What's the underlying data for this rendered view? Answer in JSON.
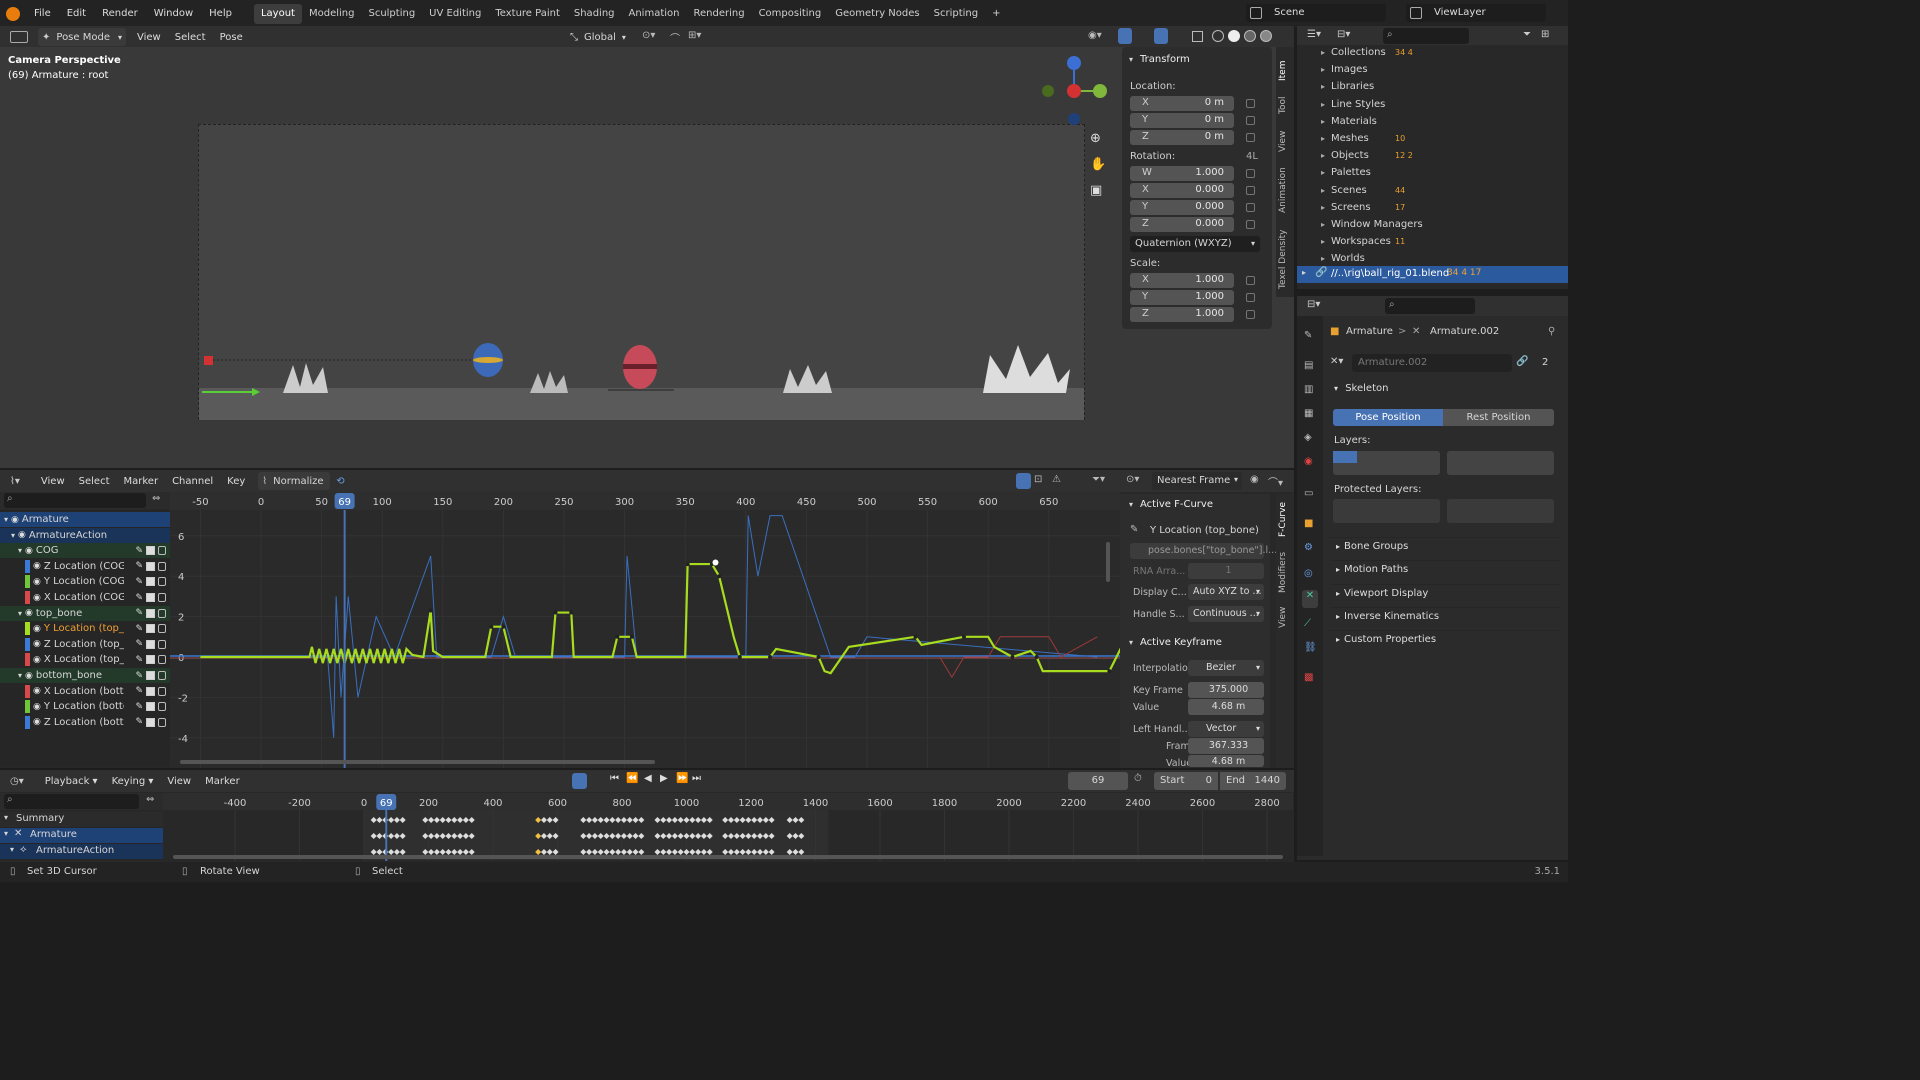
{
  "topbar": {
    "menus": [
      "File",
      "Edit",
      "Render",
      "Window",
      "Help"
    ],
    "workspaces": [
      "Layout",
      "Modeling",
      "Sculpting",
      "UV Editing",
      "Texture Paint",
      "Shading",
      "Animation",
      "Rendering",
      "Compositing",
      "Geometry Nodes",
      "Scripting"
    ],
    "active_workspace": "Layout",
    "add_tab": "+",
    "scene": "Scene",
    "view_layer": "ViewLayer"
  },
  "viewport": {
    "mode": "Pose Mode",
    "menus": [
      "View",
      "Select",
      "Pose"
    ],
    "orientation": "Global",
    "camera_title": "Camera Perspective",
    "camera_subtitle": "(69) Armature : root"
  },
  "transform_panel": {
    "title": "Transform",
    "location_label": "Location:",
    "location": [
      {
        "k": "X",
        "v": "0 m"
      },
      {
        "k": "Y",
        "v": "0 m"
      },
      {
        "k": "Z",
        "v": "0 m"
      }
    ],
    "rotation_label": "Rotation:",
    "rotation_mode_short": "4L",
    "rotation": [
      {
        "k": "W",
        "v": "1.000"
      },
      {
        "k": "X",
        "v": "0.000"
      },
      {
        "k": "Y",
        "v": "0.000"
      },
      {
        "k": "Z",
        "v": "0.000"
      }
    ],
    "rotation_mode": "Quaternion (WXYZ)",
    "scale_label": "Scale:",
    "scale": [
      {
        "k": "X",
        "v": "1.000"
      },
      {
        "k": "Y",
        "v": "1.000"
      },
      {
        "k": "Z",
        "v": "1.000"
      }
    ]
  },
  "viewport_tabs": [
    "Item",
    "Tool",
    "View",
    "Animation",
    "Texel Density"
  ],
  "outliner": {
    "items": [
      {
        "label": "Collections",
        "badges": "34 4"
      },
      {
        "label": "Images",
        "badges": ""
      },
      {
        "label": "Libraries",
        "badges": ""
      },
      {
        "label": "Line Styles",
        "badges": ""
      },
      {
        "label": "Materials",
        "badges": ""
      },
      {
        "label": "Meshes",
        "badges": "10"
      },
      {
        "label": "Objects",
        "badges": "12 2"
      },
      {
        "label": "Palettes",
        "badges": ""
      },
      {
        "label": "Scenes",
        "badges": "44"
      },
      {
        "label": "Screens",
        "badges": "17"
      },
      {
        "label": "Window Managers",
        "badges": ""
      },
      {
        "label": "Workspaces",
        "badges": "11"
      },
      {
        "label": "Worlds",
        "badges": ""
      }
    ],
    "file": "//..\\rig\\ball_rig_01.blend",
    "file_badges": "34 4 17"
  },
  "properties": {
    "breadcrumb_1": "Armature",
    "breadcrumb_sep": ">",
    "breadcrumb_2": "Armature.002",
    "data_name": "Armature.002",
    "users": "2",
    "skeleton_title": "Skeleton",
    "pose_position": "Pose Position",
    "rest_position": "Rest Position",
    "layers_label": "Layers:",
    "protected_layers_label": "Protected Layers:",
    "sections": [
      "Bone Groups",
      "Motion Paths",
      "Viewport Display",
      "Inverse Kinematics",
      "Custom Properties"
    ]
  },
  "graph_editor": {
    "menus": [
      "View",
      "Select",
      "Marker",
      "Channel",
      "Key"
    ],
    "normalize": "Normalize",
    "snap_mode": "Nearest Frame",
    "frame_ticks": [
      "-50",
      "0",
      "50",
      "69",
      "100",
      "150",
      "200",
      "250",
      "300",
      "350",
      "400",
      "450",
      "500",
      "550",
      "600",
      "650"
    ],
    "current_frame": "69",
    "y_ticks": [
      "6",
      "4",
      "2",
      "0",
      "-2",
      "-4"
    ],
    "channels": [
      {
        "label": "Armature",
        "level": 0,
        "color": "#2b5fa0"
      },
      {
        "label": "ArmatureAction",
        "level": 1,
        "color": ""
      },
      {
        "label": "COG",
        "level": 2,
        "color": ""
      },
      {
        "label": "Z Location (COG)",
        "level": 3,
        "color": "#3a7bd5"
      },
      {
        "label": "Y Location (COG)",
        "level": 3,
        "color": "#6fc63a"
      },
      {
        "label": "X Location (COG)",
        "level": 3,
        "color": "#d84a4a"
      },
      {
        "label": "top_bone",
        "level": 2,
        "color": ""
      },
      {
        "label": "Y Location (top_bor",
        "level": 3,
        "color": "#a8dc1e"
      },
      {
        "label": "Z Location (top_bor",
        "level": 3,
        "color": "#3a7bd5"
      },
      {
        "label": "X Location (top_bor",
        "level": 3,
        "color": "#d84a4a"
      },
      {
        "label": "bottom_bone",
        "level": 2,
        "color": ""
      },
      {
        "label": "X Location (bottom",
        "level": 3,
        "color": "#d84a4a"
      },
      {
        "label": "Y Location (bottom",
        "level": 3,
        "color": "#6fc63a"
      },
      {
        "label": "Z Location (bottom",
        "level": 3,
        "color": "#3a7bd5"
      }
    ]
  },
  "fcurve_panel": {
    "active_fcurve_title": "Active F-Curve",
    "fcurve_name": "Y Location (top_bone)",
    "data_path": "pose.bones[\"top_bone\"].l...",
    "rna_array_label": "RNA Arra...",
    "rna_array_value": "1",
    "display_color_label": "Display C...",
    "display_color_value": "Auto XYZ to ...",
    "handle_smoothing_label": "Handle S...",
    "handle_smoothing_value": "Continuous ...",
    "active_keyframe_title": "Active Keyframe",
    "interpolation_label": "Interpolation",
    "interpolation_value": "Bezier",
    "key_frame_label": "Key Frame",
    "key_frame_value": "375.000",
    "value_label": "Value",
    "value_value": "4.68 m",
    "left_handle_label": "Left Handl...",
    "left_handle_value": "Vector",
    "lh_frame_label": "Frame",
    "lh_frame_value": "367.333",
    "lh_value_label": "Value",
    "lh_value_value": "4.68 m",
    "tabs": [
      "F-Curve",
      "Modifiers",
      "View"
    ]
  },
  "timeline": {
    "menus": [
      "Playback",
      "Keying",
      "View",
      "Marker"
    ],
    "current_frame": "69",
    "start_label": "Start",
    "start_value": "0",
    "end_label": "End",
    "end_value": "1440",
    "ticks": [
      "-400",
      "-200",
      "0",
      "69",
      "200",
      "400",
      "600",
      "800",
      "1000",
      "1200",
      "1400",
      "1600",
      "1800",
      "2000",
      "2200",
      "2400",
      "2600",
      "2800"
    ],
    "channels": [
      "Summary",
      "Armature",
      "ArmatureAction"
    ]
  },
  "status": {
    "left": "Set 3D Cursor",
    "middle": "Rotate View",
    "right": "Select",
    "version": "3.5.1"
  }
}
